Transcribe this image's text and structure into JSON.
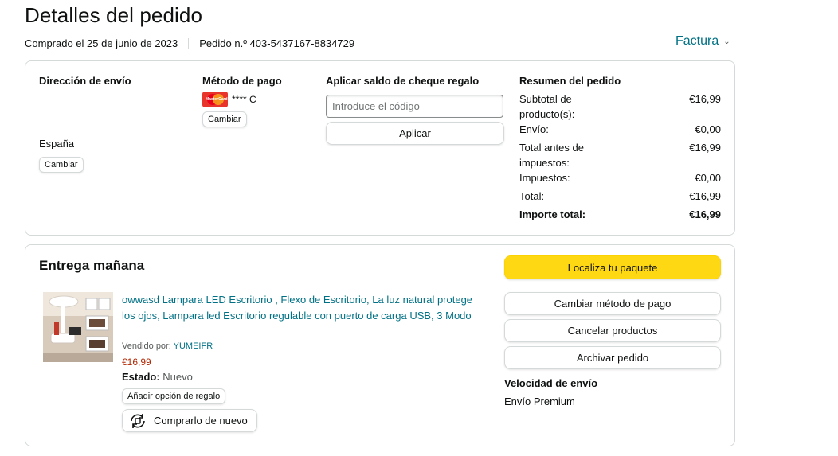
{
  "header": {
    "title": "Detalles del pedido",
    "purchased": "Comprado el 25 de junio de 2023",
    "order_number": "Pedido n.º 403-5437167-8834729",
    "invoice_label": "Factura"
  },
  "shipping": {
    "heading": "Dirección de envío",
    "country": "España",
    "change_label": "Cambiar"
  },
  "payment": {
    "heading": "Método de pago",
    "card_masked": "**** C",
    "change_label": "Cambiar"
  },
  "gift": {
    "heading": "Aplicar saldo de cheque regalo",
    "placeholder": "Introduce el código",
    "apply_label": "Aplicar"
  },
  "summary": {
    "heading": "Resumen del pedido",
    "rows": [
      {
        "label": "Subtotal de producto(s):",
        "value": "€16,99"
      },
      {
        "label": "Envío:",
        "value": "€0,00"
      },
      {
        "label": "Total antes de impuestos:",
        "value": "€16,99"
      },
      {
        "label": "Impuestos:",
        "value": "€0,00"
      },
      {
        "label": "Total:",
        "value": "€16,99"
      }
    ],
    "grand_total": {
      "label": "Importe total:",
      "value": "€16,99"
    }
  },
  "delivery": {
    "title": "Entrega mañana",
    "product": {
      "title": "owwasd Lampara LED Escritorio , Flexo de Escritorio, La luz natural protege los ojos, Lampara led Escritorio regulable con puerto de carga USB, 3 Modo",
      "sold_by_label": "Vendido por:",
      "seller": "YUMEIFR",
      "price": "€16,99",
      "state_label": "Estado:",
      "state_value": "Nuevo",
      "gift_option_label": "Añadir opción de regalo",
      "buy_again_label": "Comprarlo de nuevo"
    },
    "actions": {
      "track": "Localiza tu paquete",
      "change_payment": "Cambiar método de pago",
      "cancel": "Cancelar productos",
      "archive": "Archivar pedido"
    },
    "speed_heading": "Velocidad de envío",
    "speed_value": "Envío Premium"
  },
  "colors": {
    "link": "#007185",
    "price": "#b12704",
    "primary_button": "#ffd814",
    "border": "#d5d9d9"
  }
}
